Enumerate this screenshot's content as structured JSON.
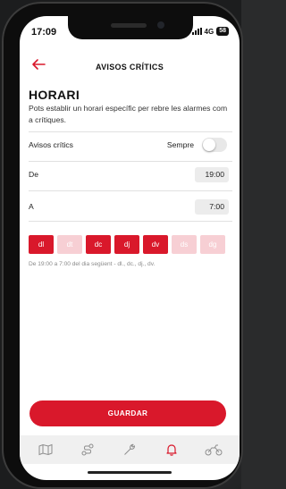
{
  "status": {
    "time": "17:09",
    "network": "4G",
    "battery": "58"
  },
  "nav": {
    "title": "AVISOS CRÍTICS",
    "back_icon": "arrow-left-icon"
  },
  "section": {
    "heading": "HORARI",
    "description": "Pots establir un horari específic per rebre les alarmes com a crítiques."
  },
  "settings": {
    "critical": {
      "label": "Avisos crítics",
      "value": "Sempre",
      "enabled": false
    },
    "from": {
      "label": "De",
      "value": "19:00"
    },
    "to": {
      "label": "A",
      "value": "7:00"
    }
  },
  "days": [
    {
      "label": "dl",
      "active": true
    },
    {
      "label": "dt",
      "active": false
    },
    {
      "label": "dc",
      "active": true
    },
    {
      "label": "dj",
      "active": true
    },
    {
      "label": "dv",
      "active": true
    },
    {
      "label": "ds",
      "active": false
    },
    {
      "label": "dg",
      "active": false
    }
  ],
  "summary": "De 19:00 a 7:00 del dia següent - dl., dc., dj., dv.",
  "save_label": "GUARDAR",
  "tabs": [
    "map-icon",
    "route-icon",
    "wrench-icon",
    "bell-icon",
    "motorbike-icon"
  ],
  "colors": {
    "accent": "#d9182b",
    "accent_light": "#f7cfd4",
    "active_tab": "#d9182b",
    "inactive_tab": "#8d8d8d"
  }
}
